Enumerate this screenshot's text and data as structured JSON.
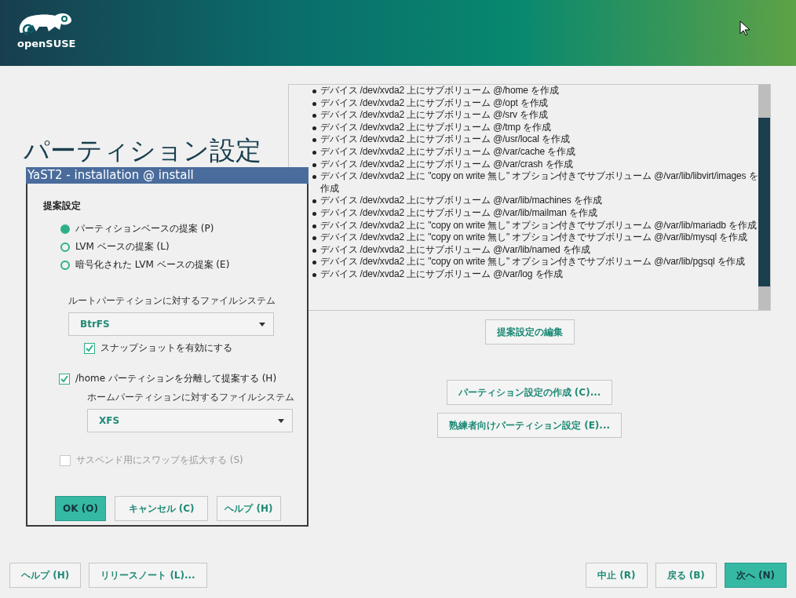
{
  "header": {
    "logo_text": "openSUSE"
  },
  "page": {
    "title": "パーティション設定"
  },
  "log": {
    "items": [
      "デバイス /dev/xvda2 上にサブボリューム @/home を作成",
      "デバイス /dev/xvda2 上にサブボリューム @/opt を作成",
      "デバイス /dev/xvda2 上にサブボリューム @/srv を作成",
      "デバイス /dev/xvda2 上にサブボリューム @/tmp を作成",
      "デバイス /dev/xvda2 上にサブボリューム @/usr/local を作成",
      "デバイス /dev/xvda2 上にサブボリューム @/var/cache を作成",
      "デバイス /dev/xvda2 上にサブボリューム @/var/crash を作成",
      "デバイス /dev/xvda2 上に \"copy on write 無し\" オプション付きでサブボリューム @/var/lib/libvirt/images を作成",
      "デバイス /dev/xvda2 上にサブボリューム @/var/lib/machines を作成",
      "デバイス /dev/xvda2 上にサブボリューム @/var/lib/mailman を作成",
      "デバイス /dev/xvda2 上に \"copy on write 無し\" オプション付きでサブボリューム @/var/lib/mariadb を作成",
      "デバイス /dev/xvda2 上に \"copy on write 無し\" オプション付きでサブボリューム @/var/lib/mysql を作成",
      "デバイス /dev/xvda2 上にサブボリューム @/var/lib/named を作成",
      "デバイス /dev/xvda2 上に \"copy on write 無し\" オプション付きでサブボリューム @/var/lib/pgsql を作成",
      "デバイス /dev/xvda2 上にサブボリューム @/var/log を作成"
    ]
  },
  "actions": [
    {
      "label": "提案設定の編集"
    },
    {
      "label": "パーティション設定の作成 (C)..."
    },
    {
      "label": "熟練者向けパーティション設定 (E)..."
    }
  ],
  "dialog": {
    "title": "YaST2 - installation @ install",
    "section": "提案設定",
    "proposal_types": [
      {
        "label": "パーティションベースの提案 (P)",
        "selected": true
      },
      {
        "label": "LVM ベースの提案 (L)",
        "selected": false
      },
      {
        "label": "暗号化された LVM ベースの提案 (E)",
        "selected": false
      }
    ],
    "root_fs": {
      "label": "ルートパーティションに対するファイルシステム",
      "value": "BtrFS"
    },
    "snapshots": {
      "label": "スナップショットを有効にする",
      "checked": true,
      "disabled": false
    },
    "separate_home": {
      "label": "/home パーティションを分離して提案する (H)",
      "checked": true,
      "disabled": false
    },
    "home_fs": {
      "label": "ホームパーティションに対するファイルシステム",
      "value": "XFS"
    },
    "enlarge_swap": {
      "label": "サスペンド用にスワップを拡大する (S)",
      "checked": false,
      "disabled": true
    },
    "buttons": [
      {
        "label": "OK (O)",
        "primary": true
      },
      {
        "label": "キャンセル (C)",
        "primary": false
      },
      {
        "label": "ヘルプ (H)",
        "primary": false
      }
    ]
  },
  "footer": {
    "left": [
      {
        "label": "ヘルプ (H)",
        "primary": false
      },
      {
        "label": "リリースノート (L)...",
        "primary": false
      }
    ],
    "right": [
      {
        "label": "中止 (R)",
        "primary": false
      },
      {
        "label": "戻る (B)",
        "primary": false
      },
      {
        "label": "次へ (N)",
        "primary": true
      }
    ]
  }
}
